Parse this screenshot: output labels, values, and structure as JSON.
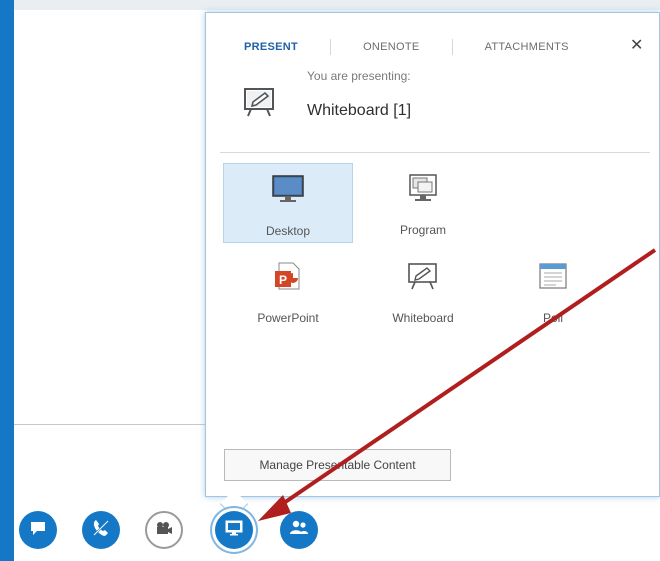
{
  "flyout": {
    "tabs": [
      {
        "label": "PRESENT",
        "active": true
      },
      {
        "label": "ONENOTE",
        "active": false
      },
      {
        "label": "ATTACHMENTS",
        "active": false
      }
    ],
    "close_glyph": "✕",
    "presenting": {
      "label": "You are presenting:",
      "value": "Whiteboard [1]",
      "icon": "whiteboard-icon"
    },
    "options": [
      {
        "label": "Desktop",
        "icon": "desktop-icon",
        "selected": true
      },
      {
        "label": "Program",
        "icon": "program-icon",
        "selected": false
      },
      {
        "label": "PowerPoint",
        "icon": "powerpoint-icon",
        "selected": false
      },
      {
        "label": "Whiteboard",
        "icon": "whiteboard-icon",
        "selected": false
      },
      {
        "label": "Poll",
        "icon": "poll-icon",
        "selected": false
      }
    ],
    "manage_button": "Manage Presentable Content"
  },
  "toolbar": {
    "buttons": [
      {
        "name": "im",
        "icon": "chat-bubble-icon"
      },
      {
        "name": "audio",
        "icon": "phone-icon"
      },
      {
        "name": "video",
        "icon": "video-camera-icon"
      },
      {
        "name": "present",
        "icon": "monitor-icon",
        "active": true
      },
      {
        "name": "participants",
        "icon": "people-icon"
      }
    ]
  },
  "colors": {
    "accent": "#1478c6",
    "selected_bg": "#dcebf8",
    "annotation_arrow": "#b01e1e"
  }
}
